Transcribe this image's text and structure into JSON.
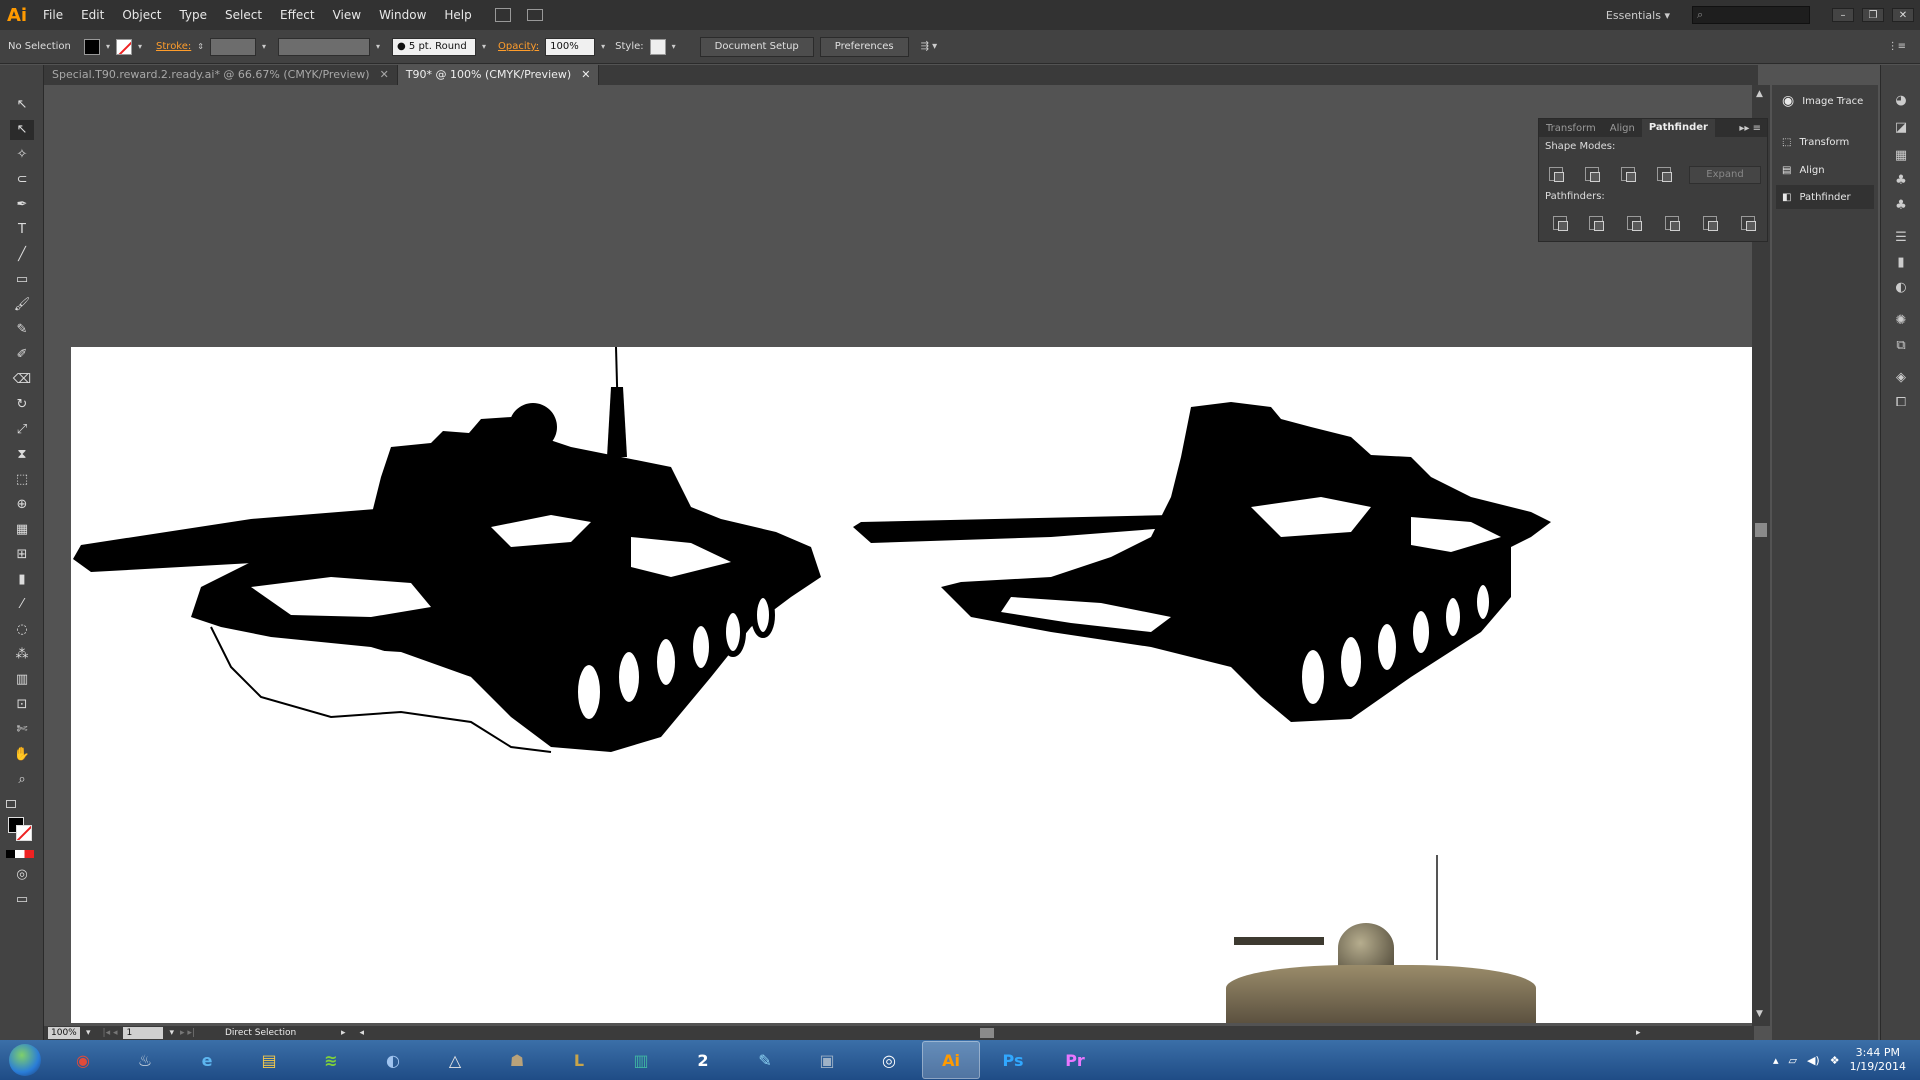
{
  "app": {
    "logo": "Ai"
  },
  "menu": [
    "File",
    "Edit",
    "Object",
    "Type",
    "Select",
    "Effect",
    "View",
    "Window",
    "Help"
  ],
  "workspace": "Essentials",
  "control": {
    "selection": "No Selection",
    "stroke_label": "Stroke:",
    "brush": "5 pt. Round",
    "opacity_label": "Opacity:",
    "opacity_value": "100%",
    "style_label": "Style:",
    "document_setup": "Document Setup",
    "preferences": "Preferences"
  },
  "tabs": [
    {
      "label": "Special.T90.reward.2.ready.ai* @ 66.67% (CMYK/Preview)",
      "active": false
    },
    {
      "label": "T90* @ 100% (CMYK/Preview)",
      "active": true
    }
  ],
  "pathfinder": {
    "tabs": [
      "Transform",
      "Align",
      "Pathfinder"
    ],
    "shape_modes_label": "Shape Modes:",
    "pathfinders_label": "Pathfinders:",
    "expand": "Expand"
  },
  "panels": [
    "Image Trace",
    "Transform",
    "Align",
    "Pathfinder"
  ],
  "status": {
    "zoom": "100%",
    "page": "1",
    "tool": "Direct Selection"
  },
  "clock": {
    "time": "3:44 PM",
    "date": "1/19/2014"
  },
  "taskbar": [
    {
      "name": "chrome",
      "glyph": "◉",
      "color": "#e04b3a"
    },
    {
      "name": "steam",
      "glyph": "♨",
      "color": "#cfd8e0"
    },
    {
      "name": "internet-explorer",
      "glyph": "e",
      "color": "#5db6f0"
    },
    {
      "name": "file-explorer",
      "glyph": "▤",
      "color": "#f4c94a"
    },
    {
      "name": "spotify",
      "glyph": "≋",
      "color": "#7fd13b"
    },
    {
      "name": "media",
      "glyph": "◐",
      "color": "#a0c4f0"
    },
    {
      "name": "utility",
      "glyph": "△",
      "color": "#e6e6e6"
    },
    {
      "name": "game",
      "glyph": "☗",
      "color": "#b9a27a"
    },
    {
      "name": "league",
      "glyph": "L",
      "color": "#c8a44a"
    },
    {
      "name": "chart-app",
      "glyph": "▥",
      "color": "#3fb5a2"
    },
    {
      "name": "app-2",
      "glyph": "2",
      "color": "#ffffff"
    },
    {
      "name": "notes",
      "glyph": "✎",
      "color": "#8fd4f4"
    },
    {
      "name": "video",
      "glyph": "▣",
      "color": "#9fb2c6"
    },
    {
      "name": "obs",
      "glyph": "◎",
      "color": "#ffffff"
    },
    {
      "name": "illustrator",
      "glyph": "Ai",
      "color": "#ff9a00",
      "active": true
    },
    {
      "name": "photoshop",
      "glyph": "Ps",
      "color": "#31a8ff"
    },
    {
      "name": "premiere",
      "glyph": "Pr",
      "color": "#ea77ff"
    }
  ]
}
